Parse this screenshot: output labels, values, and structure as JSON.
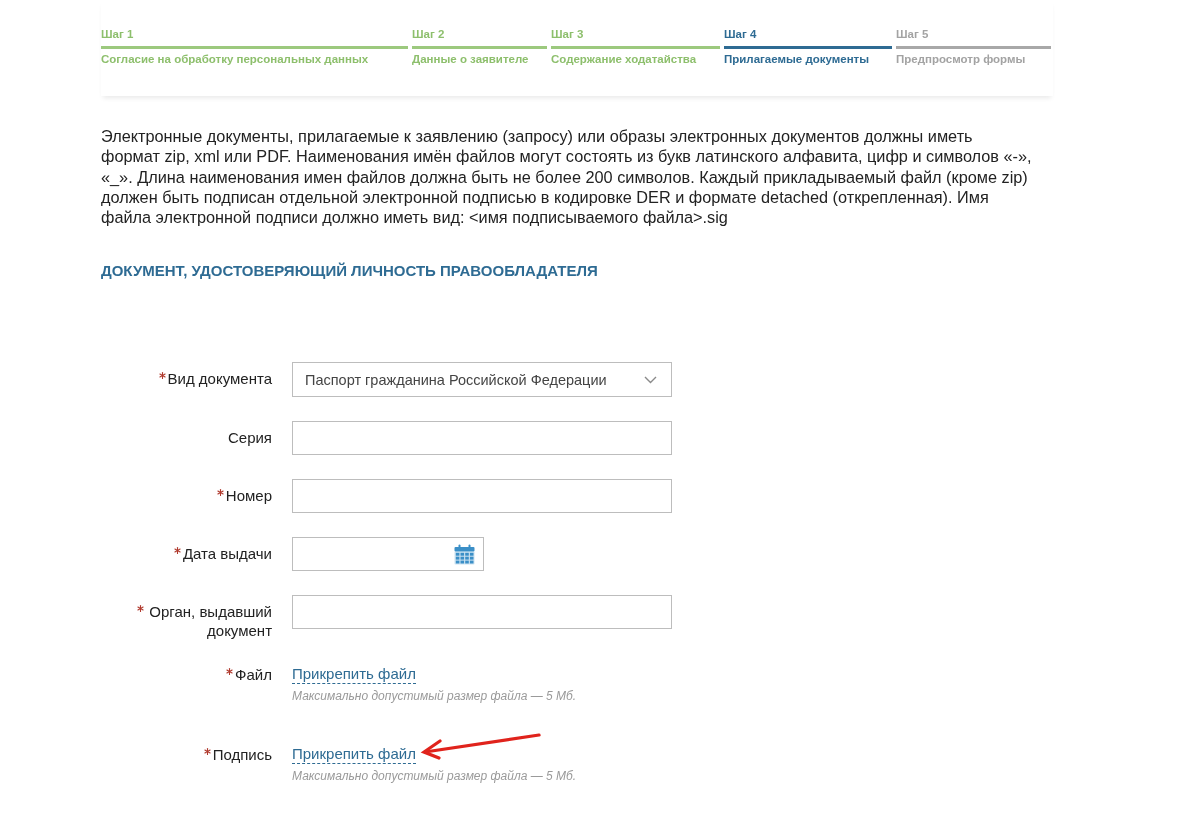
{
  "stepper": [
    {
      "step": "Шаг 1",
      "title": "Согласие на обработку персональных данных",
      "completed": true,
      "selected": false
    },
    {
      "step": "Шаг 2",
      "title": "Данные о заявителе",
      "completed": true,
      "selected": false
    },
    {
      "step": "Шаг 3",
      "title": "Содержание ходатайства",
      "completed": true,
      "selected": false
    },
    {
      "step": "Шаг 4",
      "title": "Прилагаемые документы",
      "completed": false,
      "selected": true
    },
    {
      "step": "Шаг 5",
      "title": "Предпросмотр формы",
      "completed": false,
      "selected": false
    }
  ],
  "instructions": "Электронные документы, прилагаемые к заявлению (запросу) или образы электронных документов должны иметь формат zip, xml или PDF. Наименования имён файлов могут состоять из букв латинского алфавита, цифр и символов «-», «_». Длина наименования имен файлов должна быть не более 200 символов. Каждый прикладываемый файл (кроме zip) должен быть подписан отдельной электронной подписью в кодировке DER и формате detached (открепленная). Имя файла электронной подписи должно иметь вид: <имя подписываемого файла>.sig",
  "section_title": "ДОКУМЕНТ, УДОСТОВЕРЯЮЩИЙ ЛИЧНОСТЬ ПРАВООБЛАДАТЕЛЯ",
  "fields": [
    {
      "kind": "select",
      "label": "Вид документа",
      "required": true,
      "value": "Паспорт гражданина Российской Федерации",
      "annotated": false
    },
    {
      "kind": "text",
      "label": "Серия",
      "required": false,
      "annotated": false
    },
    {
      "kind": "text",
      "label": "Номер",
      "required": true,
      "annotated": false
    },
    {
      "kind": "date",
      "label": "Дата выдачи",
      "required": true,
      "annotated": false
    },
    {
      "kind": "text",
      "label": "Орган, выдавший документ",
      "required": true,
      "annotated": false
    },
    {
      "kind": "file",
      "label": "Файл",
      "required": true,
      "link": "Прикрепить файл",
      "hint": "Максимально допустимый размер файла — 5 Мб.",
      "annotated": false
    },
    {
      "kind": "file",
      "label": "Подпись",
      "required": true,
      "link": "Прикрепить файл",
      "hint": "Максимально допустимый размер файла — 5 Мб.",
      "annotated": true
    }
  ]
}
